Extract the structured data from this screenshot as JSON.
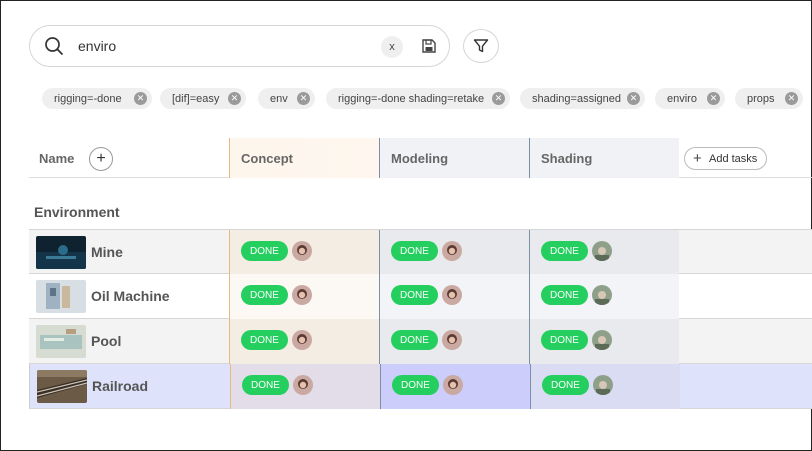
{
  "search": {
    "query": "enviro",
    "clear_label": "x"
  },
  "filters": [
    {
      "label": "rigging=-done"
    },
    {
      "label": "[dif]=easy"
    },
    {
      "label": "env"
    },
    {
      "label": "rigging=-done shading=retake"
    },
    {
      "label": "shading=assigned"
    },
    {
      "label": "enviro"
    },
    {
      "label": "props"
    }
  ],
  "table": {
    "name_header": "Name",
    "add_column": "+",
    "columns": [
      {
        "label": "Concept"
      },
      {
        "label": "Modeling"
      },
      {
        "label": "Shading"
      }
    ],
    "add_tasks_label": "Add tasks",
    "group": "Environment",
    "rows": [
      {
        "name": "Mine",
        "concept": "DONE",
        "modeling": "DONE",
        "shading": "DONE"
      },
      {
        "name": "Oil Machine",
        "concept": "DONE",
        "modeling": "DONE",
        "shading": "DONE"
      },
      {
        "name": "Pool",
        "concept": "DONE",
        "modeling": "DONE",
        "shading": "DONE"
      },
      {
        "name": "Railroad",
        "concept": "DONE",
        "modeling": "DONE",
        "shading": "DONE"
      }
    ]
  },
  "colors": {
    "done": "#24cf5f",
    "concept_border": "#e9b982",
    "task_border": "#7b8fa6",
    "selected_row": "#dfe2fb"
  }
}
